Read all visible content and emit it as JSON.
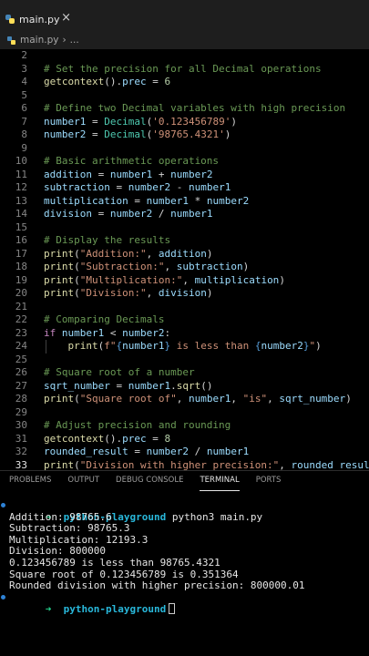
{
  "tab": {
    "filename": "main.py",
    "close_glyph": "×"
  },
  "breadcrumb": {
    "file": "main.py",
    "separator": "›",
    "rest": "..."
  },
  "editor": {
    "current_line": 33,
    "lines": [
      {
        "n": "2",
        "text": ""
      },
      {
        "n": "3",
        "text": "# Set the precision for all Decimal operations"
      },
      {
        "n": "4",
        "text": "getcontext().prec = 6"
      },
      {
        "n": "5",
        "text": ""
      },
      {
        "n": "6",
        "text": "# Define two Decimal variables with high precision"
      },
      {
        "n": "7",
        "text": "number1 = Decimal('0.123456789')"
      },
      {
        "n": "8",
        "text": "number2 = Decimal('98765.4321')"
      },
      {
        "n": "9",
        "text": ""
      },
      {
        "n": "10",
        "text": "# Basic arithmetic operations"
      },
      {
        "n": "11",
        "text": "addition = number1 + number2"
      },
      {
        "n": "12",
        "text": "subtraction = number2 - number1"
      },
      {
        "n": "13",
        "text": "multiplication = number1 * number2"
      },
      {
        "n": "14",
        "text": "division = number2 / number1"
      },
      {
        "n": "15",
        "text": ""
      },
      {
        "n": "16",
        "text": "# Display the results"
      },
      {
        "n": "17",
        "text": "print(\"Addition:\", addition)"
      },
      {
        "n": "18",
        "text": "print(\"Subtraction:\", subtraction)"
      },
      {
        "n": "19",
        "text": "print(\"Multiplication:\", multiplication)"
      },
      {
        "n": "20",
        "text": "print(\"Division:\", division)"
      },
      {
        "n": "21",
        "text": ""
      },
      {
        "n": "22",
        "text": "# Comparing Decimals"
      },
      {
        "n": "23",
        "text": "if number1 < number2:"
      },
      {
        "n": "24",
        "text": "    print(f\"{number1} is less than {number2}\")"
      },
      {
        "n": "25",
        "text": ""
      },
      {
        "n": "26",
        "text": "# Square root of a number"
      },
      {
        "n": "27",
        "text": "sqrt_number = number1.sqrt()"
      },
      {
        "n": "28",
        "text": "print(\"Square root of\", number1, \"is\", sqrt_number)"
      },
      {
        "n": "29",
        "text": ""
      },
      {
        "n": "30",
        "text": "# Adjust precision and rounding"
      },
      {
        "n": "31",
        "text": "getcontext().prec = 8"
      },
      {
        "n": "32",
        "text": "rounded_result = number2 / number1"
      },
      {
        "n": "33",
        "text": "print(\"Division with higher precision:\", rounded_result)"
      }
    ]
  },
  "panel": {
    "tabs": [
      {
        "label": "PROBLEMS",
        "active": false
      },
      {
        "label": "OUTPUT",
        "active": false
      },
      {
        "label": "DEBUG CONSOLE",
        "active": false
      },
      {
        "label": "TERMINAL",
        "active": true
      },
      {
        "label": "PORTS",
        "active": false
      }
    ]
  },
  "terminal": {
    "prompt_arrow": "➜",
    "prompt_dir": "python-playground",
    "command": "python3 main.py",
    "output": [
      "Addition: 98765.6",
      "Subtraction: 98765.3",
      "Multiplication: 12193.3",
      "Division: 800000",
      "0.123456789 is less than 98765.4321",
      "Square root of 0.123456789 is 0.351364",
      "Rounded division with higher precision: 800000.01"
    ],
    "colors": {
      "dot": "#2e82d6",
      "arrow": "#23d18b",
      "dir": "#29b8db"
    }
  }
}
